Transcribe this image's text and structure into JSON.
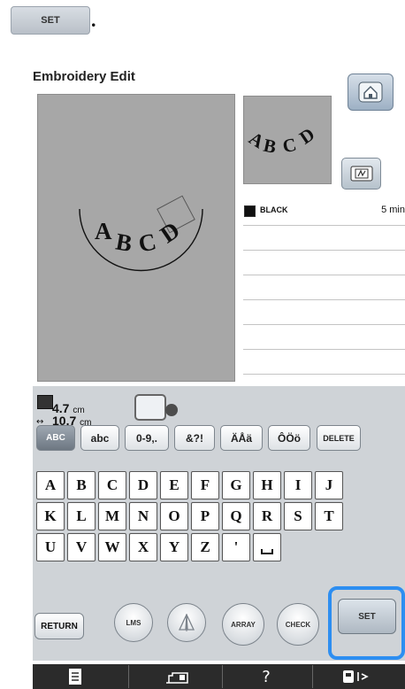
{
  "instruction": {
    "chip_label": "SET",
    "period": "."
  },
  "screen": {
    "title": "Embroidery Edit",
    "design_text": "ABCD",
    "thread": {
      "color_name": "BLACK",
      "time": "5 min"
    },
    "size": {
      "height_value": "4.7",
      "width_value": "10.7",
      "unit": "cm"
    },
    "tabs": [
      "ABC",
      "abc",
      "0-9,.",
      "&?!",
      "ÄÅä",
      "ÔÖö",
      "DELETE"
    ],
    "keyboard_rows": [
      [
        "A",
        "B",
        "C",
        "D",
        "E",
        "F",
        "G",
        "H",
        "I",
        "J"
      ],
      [
        "K",
        "L",
        "M",
        "N",
        "O",
        "P",
        "Q",
        "R",
        "S",
        "T"
      ],
      [
        "U",
        "V",
        "W",
        "X",
        "Y",
        "Z",
        "'",
        "␣"
      ]
    ],
    "buttons": {
      "return": "RETURN",
      "lms": "LMS",
      "array": "ARRAY",
      "check": "CHECK",
      "set": "SET"
    },
    "bottom_bar": {
      "help": "?"
    },
    "colors": {
      "accent_blue": "#2d8ef1",
      "canvas_gray": "#a7a7a7",
      "panel_gray": "#cfd3d7",
      "bar_dark": "#2b2b2b"
    }
  }
}
